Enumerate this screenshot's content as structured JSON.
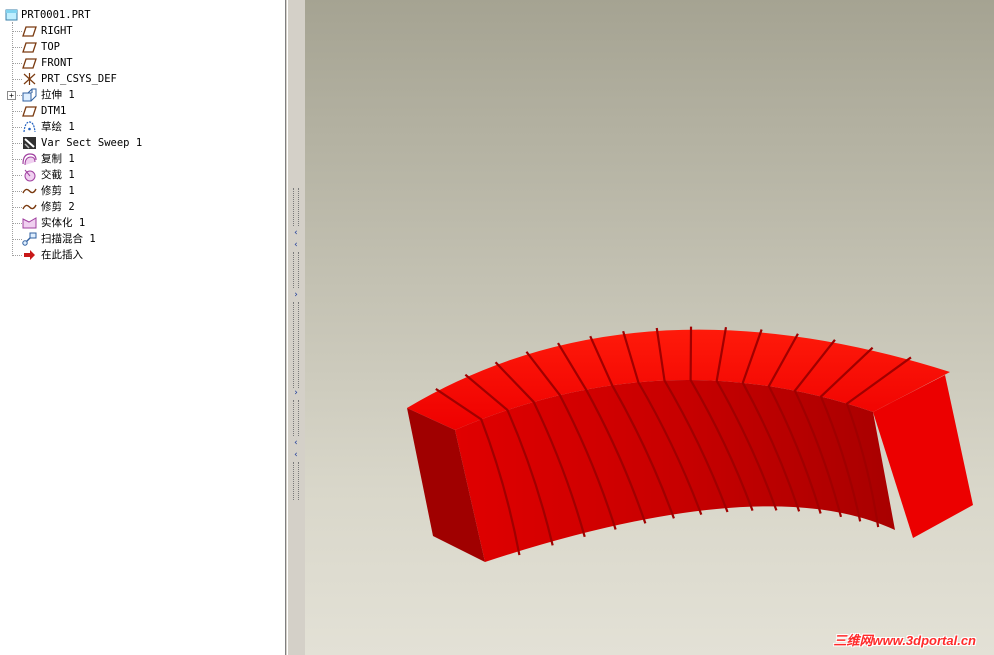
{
  "model_tree": {
    "root": {
      "label": "PRT0001.PRT",
      "icon": "part-icon"
    },
    "items": [
      {
        "label": "RIGHT",
        "icon": "datum-plane-icon",
        "expandable": false
      },
      {
        "label": "TOP",
        "icon": "datum-plane-icon",
        "expandable": false
      },
      {
        "label": "FRONT",
        "icon": "datum-plane-icon",
        "expandable": false
      },
      {
        "label": "PRT_CSYS_DEF",
        "icon": "coordinate-system-icon",
        "expandable": false
      },
      {
        "label": "拉伸 1",
        "icon": "extrude-icon",
        "expandable": true
      },
      {
        "label": "DTM1",
        "icon": "datum-plane-icon",
        "expandable": false
      },
      {
        "label": "草绘 1",
        "icon": "sketch-icon",
        "expandable": false
      },
      {
        "label": "Var Sect Sweep 1",
        "icon": "var-sect-sweep-icon",
        "expandable": false
      },
      {
        "label": "复制 1",
        "icon": "copy-surface-icon",
        "expandable": false
      },
      {
        "label": "交截 1",
        "icon": "intersect-icon",
        "expandable": false
      },
      {
        "label": "修剪 1",
        "icon": "trim-curve-icon",
        "expandable": false
      },
      {
        "label": "修剪 2",
        "icon": "trim-curve-icon",
        "expandable": false
      },
      {
        "label": "实体化 1",
        "icon": "solidify-icon",
        "expandable": false
      },
      {
        "label": "扫描混合 1",
        "icon": "swept-blend-icon",
        "expandable": false
      },
      {
        "label": "在此插入",
        "icon": "insert-here-arrow-icon",
        "expandable": false
      }
    ]
  },
  "viewport": {
    "model_color": "#ff0000",
    "background_top": "#a5a392",
    "background_bottom": "#e3e1d6"
  },
  "watermark": {
    "text": "三维网www.3dportal.cn"
  }
}
